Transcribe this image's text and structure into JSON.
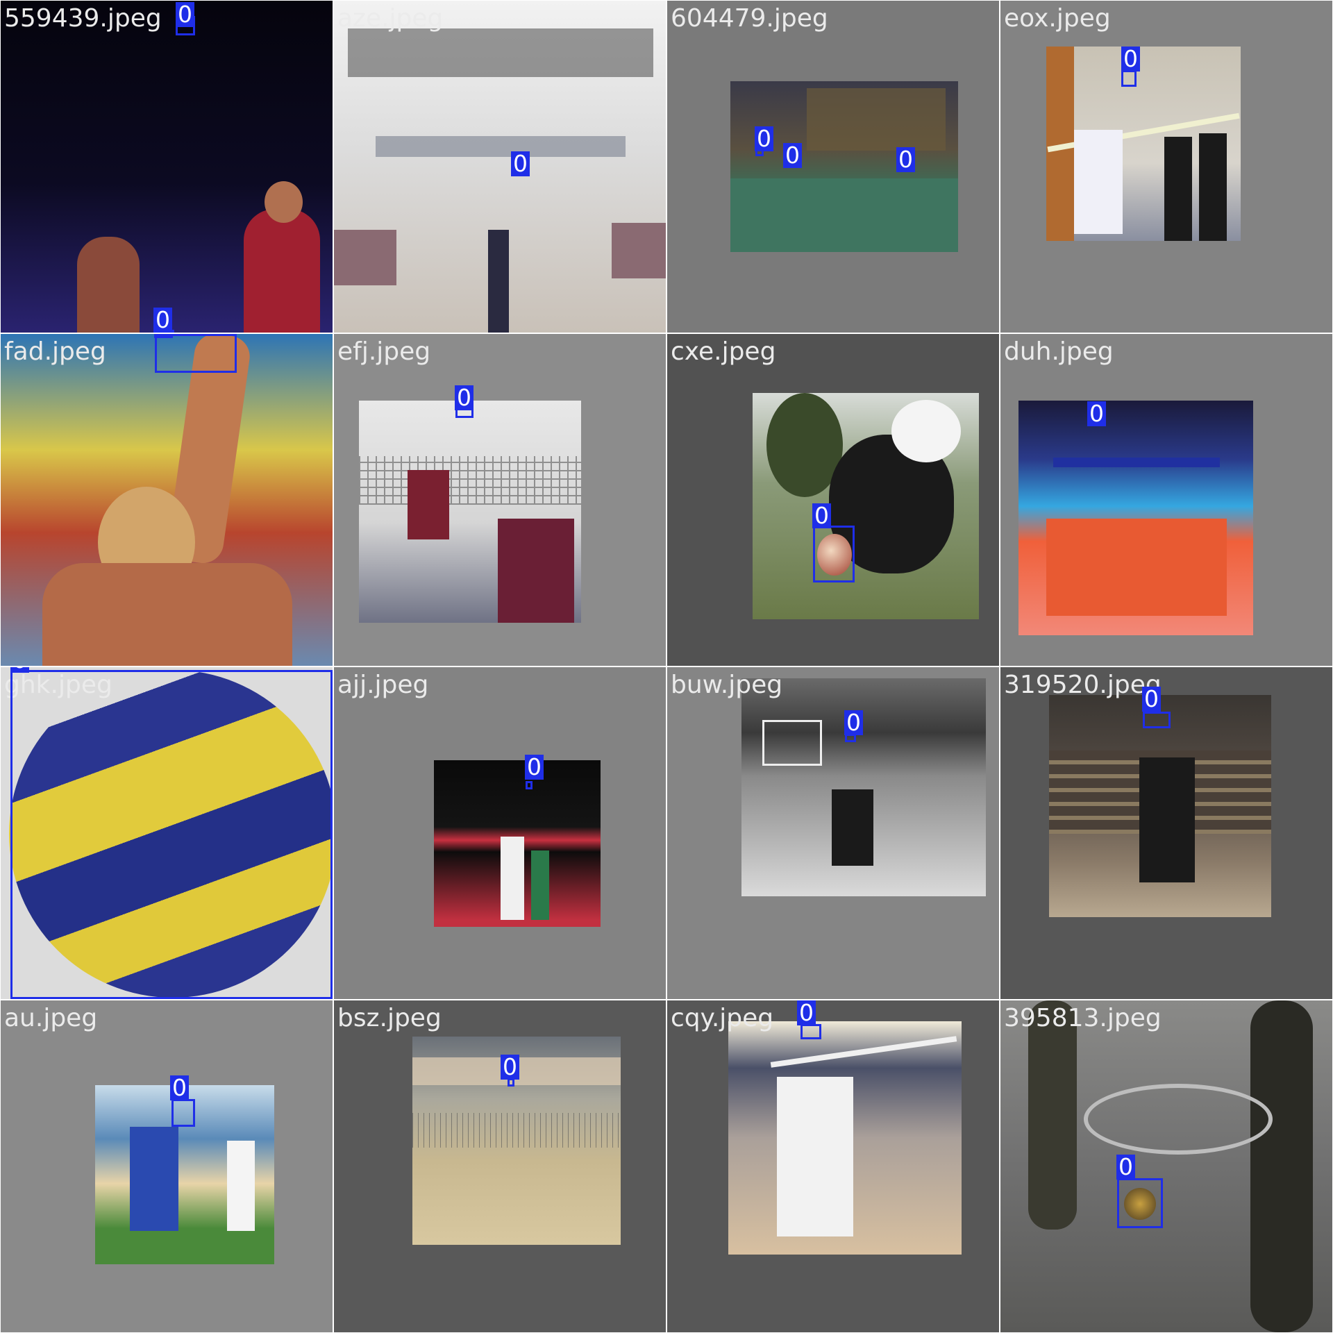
{
  "mosaic": {
    "class_label": "0",
    "box_color": "#1f2ee8",
    "tiles": [
      {
        "file": "559439.jpeg"
      },
      {
        "file": "aze.jpeg"
      },
      {
        "file": "604479.jpeg"
      },
      {
        "file": "eox.jpeg"
      },
      {
        "file": "fad.jpeg"
      },
      {
        "file": "efj.jpeg"
      },
      {
        "file": "cxe.jpeg"
      },
      {
        "file": "duh.jpeg"
      },
      {
        "file": "ghk.jpeg"
      },
      {
        "file": "ajj.jpeg"
      },
      {
        "file": "buw.jpeg"
      },
      {
        "file": "319520.jpeg"
      },
      {
        "file": "au.jpeg"
      },
      {
        "file": "bsz.jpeg"
      },
      {
        "file": "cqy.jpeg"
      },
      {
        "file": "395813.jpeg"
      }
    ]
  }
}
